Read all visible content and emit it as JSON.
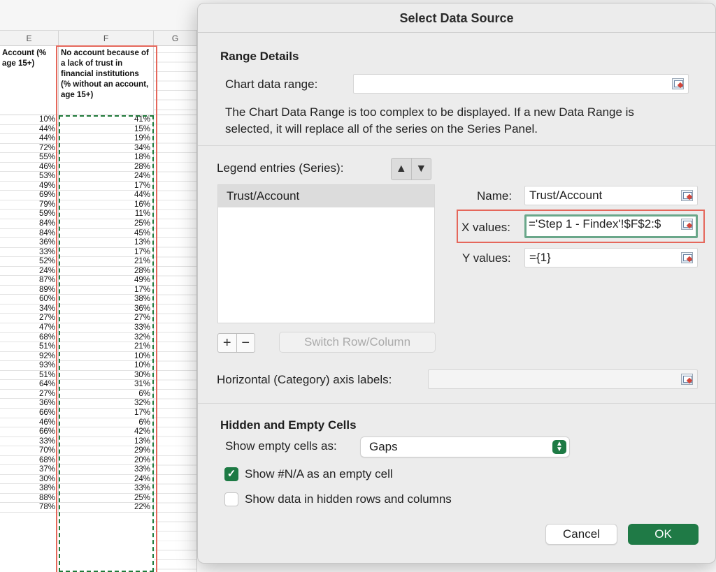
{
  "spreadsheet": {
    "columns": [
      "E",
      "F",
      "G"
    ],
    "col_e_header": "Account (% age 15+)",
    "col_f_header": "No account because of a lack of trust in financial institutions (% without an account, age 15+)",
    "col_e_values": [
      "10%",
      "44%",
      "44%",
      "72%",
      "55%",
      "46%",
      "53%",
      "49%",
      "69%",
      "79%",
      "59%",
      "84%",
      "84%",
      "36%",
      "33%",
      "52%",
      "24%",
      "87%",
      "89%",
      "60%",
      "34%",
      "27%",
      "47%",
      "68%",
      "51%",
      "92%",
      "93%",
      "51%",
      "64%",
      "27%",
      "36%",
      "66%",
      "46%",
      "66%",
      "33%",
      "70%",
      "68%",
      "37%",
      "30%",
      "38%",
      "88%",
      "78%"
    ],
    "col_f_values": [
      "41%",
      "15%",
      "19%",
      "34%",
      "18%",
      "28%",
      "24%",
      "17%",
      "44%",
      "16%",
      "11%",
      "25%",
      "45%",
      "13%",
      "17%",
      "21%",
      "28%",
      "49%",
      "17%",
      "38%",
      "36%",
      "27%",
      "33%",
      "32%",
      "21%",
      "10%",
      "10%",
      "30%",
      "31%",
      "6%",
      "32%",
      "17%",
      "6%",
      "42%",
      "13%",
      "29%",
      "20%",
      "33%",
      "24%",
      "33%",
      "25%",
      "22%"
    ]
  },
  "dialog": {
    "title": "Select Data Source",
    "range_details": {
      "heading": "Range Details",
      "chart_data_range_label": "Chart data range:",
      "chart_data_range_value": "",
      "message": "The Chart Data Range is too complex to be displayed. If a new Data Range is selected, it will replace all of the series on the Series Panel."
    },
    "legend": {
      "label": "Legend entries (Series):",
      "series": [
        "Trust/Account"
      ],
      "add_label": "+",
      "remove_label": "−",
      "switch_label": "Switch Row/Column"
    },
    "series_fields": {
      "name_label": "Name:",
      "name_value": "Trust/Account",
      "x_label": "X values:",
      "x_value": "='Step 1 - Findex'!$F$2:$",
      "y_label": "Y values:",
      "y_value": "={1}"
    },
    "axis_labels": {
      "label": "Horizontal (Category) axis labels:",
      "value": ""
    },
    "hidden_empty": {
      "heading": "Hidden and Empty Cells",
      "show_empty_label": "Show empty cells as:",
      "show_empty_value": "Gaps",
      "na_label": "Show #N/A as an empty cell",
      "na_checked": true,
      "hidden_label": "Show data in hidden rows and columns",
      "hidden_checked": false
    },
    "buttons": {
      "cancel": "Cancel",
      "ok": "OK"
    }
  },
  "colors": {
    "accent_green": "#1f7a46",
    "highlight_red": "#e5675b",
    "focus_green": "#6aa78a"
  }
}
